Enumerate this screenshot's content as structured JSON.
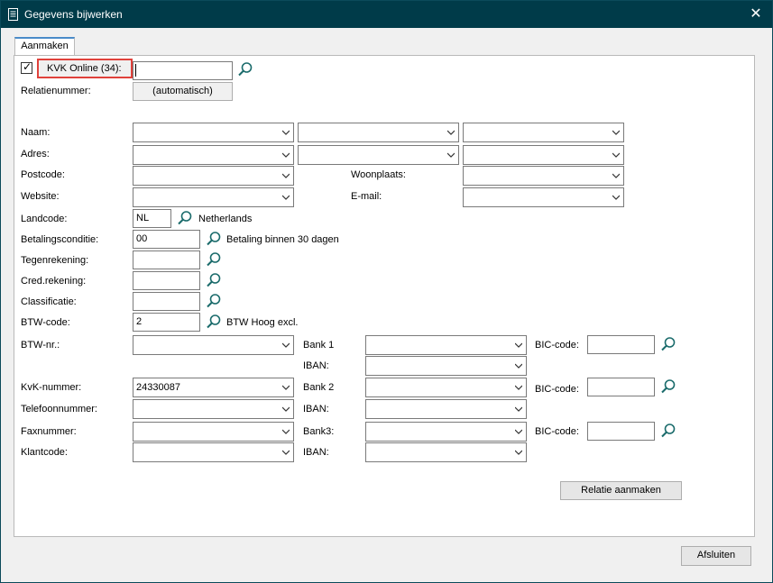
{
  "window": {
    "title": "Gegevens bijwerken",
    "close_glyph": "✕",
    "icon": "document-icon"
  },
  "tabs": [
    {
      "label": "Aanmaken",
      "active": true
    }
  ],
  "kvk_online": {
    "label": "KVK Online (34):",
    "checked": true,
    "check_glyph": "✓",
    "value": ""
  },
  "relatienummer": {
    "label": "Relatienummer:",
    "value": "(automatisch)"
  },
  "fields": {
    "naam": {
      "label": "Naam:"
    },
    "adres": {
      "label": "Adres:"
    },
    "postcode": {
      "label": "Postcode:"
    },
    "woonplaats": {
      "label": "Woonplaats:"
    },
    "website": {
      "label": "Website:"
    },
    "email": {
      "label": "E-mail:"
    },
    "landcode": {
      "label": "Landcode:",
      "value": "NL",
      "description": "Netherlands"
    },
    "betalingsconditie": {
      "label": "Betalingsconditie:",
      "value": "00",
      "description": "Betaling binnen 30 dagen"
    },
    "tegenrekening": {
      "label": "Tegenrekening:",
      "value": ""
    },
    "credrekening": {
      "label": "Cred.rekening:",
      "value": ""
    },
    "classificatie": {
      "label": "Classificatie:",
      "value": ""
    },
    "btwcode": {
      "label": "BTW-code:",
      "value": "2",
      "description": "BTW Hoog excl."
    },
    "btwnr": {
      "label": "BTW-nr.:"
    },
    "kvknummer": {
      "label": "KvK-nummer:",
      "value": "24330087"
    },
    "telefoonnummer": {
      "label": "Telefoonnummer:"
    },
    "faxnummer": {
      "label": "Faxnummer:"
    },
    "klantcode": {
      "label": "Klantcode:"
    }
  },
  "bank": {
    "bank1": {
      "label": "Bank 1",
      "iban_label": "IBAN:",
      "bic_label": "BIC-code:"
    },
    "bank2": {
      "label": "Bank 2",
      "iban_label": "IBAN:",
      "bic_label": "BIC-code:"
    },
    "bank3": {
      "label": "Bank3:",
      "iban_label": "IBAN:",
      "bic_label": "BIC-code:"
    }
  },
  "buttons": {
    "create": "Relatie aanmaken",
    "close": "Afsluiten"
  },
  "colors": {
    "titlebar": "#003b49",
    "highlight": "#e0413b",
    "search_icon": "#1a6b6b"
  }
}
